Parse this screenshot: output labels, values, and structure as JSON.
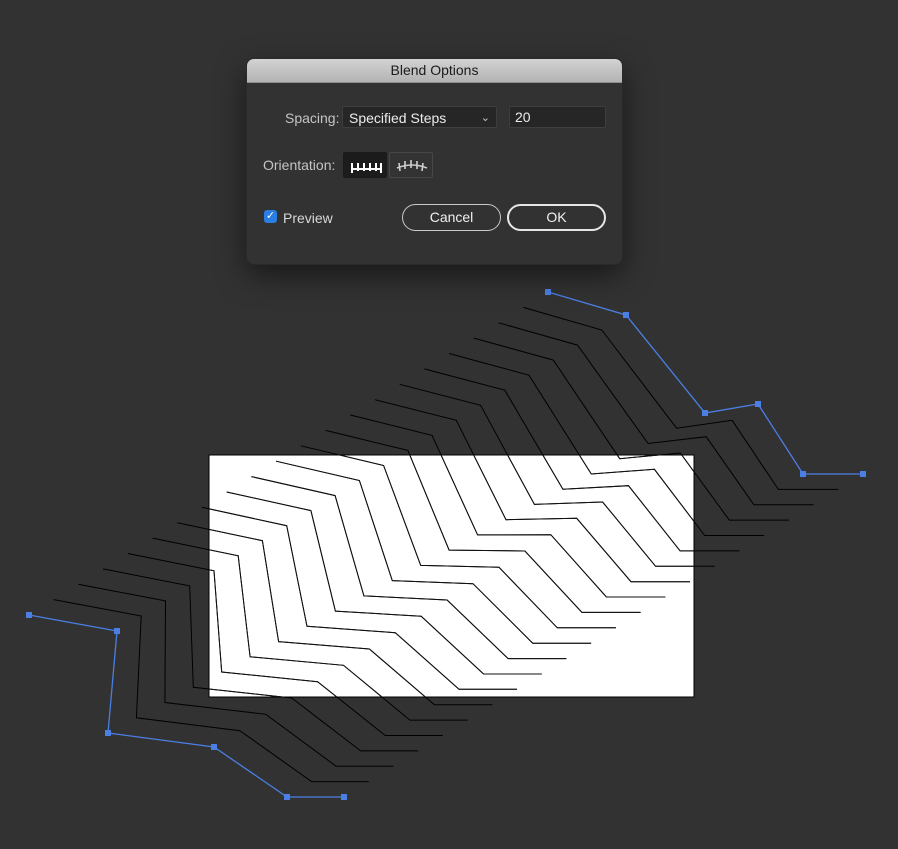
{
  "dialog": {
    "title": "Blend Options",
    "spacing_label": "Spacing:",
    "spacing_value": "Specified Steps",
    "steps_value": "20",
    "orientation_label": "Orientation:",
    "orientation_options": [
      "align-to-page-icon",
      "align-to-path-icon"
    ],
    "orientation_selected": "align-to-page-icon",
    "preview_label": "Preview",
    "preview_checked": true,
    "cancel_label": "Cancel",
    "ok_label": "OK"
  },
  "colors": {
    "canvas_bg": "#323233",
    "artboard": "#ffffff",
    "selection": "#4b7fe4",
    "checkbox": "#2a7de1"
  }
}
